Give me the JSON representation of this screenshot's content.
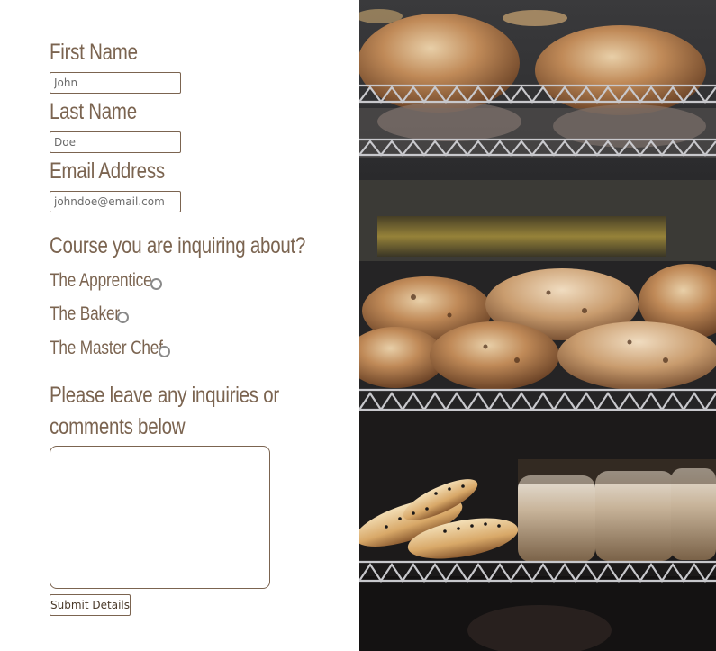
{
  "form": {
    "fields": [
      {
        "label": "First Name",
        "placeholder": "John"
      },
      {
        "label": "Last Name",
        "placeholder": "Doe"
      },
      {
        "label": "Email Address",
        "placeholder": "johndoe@email.com"
      }
    ],
    "course_heading": "Course you are inquiring about?",
    "courses": [
      "The Apprentice",
      "The Baker",
      "The Master Chef"
    ],
    "comments_heading_line1": "Please leave any inquiries or",
    "comments_heading_line2": "comments below",
    "submit_label": "Submit Details"
  },
  "photo": {
    "subject": "bakery display shelves with bread loaves and poppy-seed rolls"
  },
  "colors": {
    "label_brown": "#7b6450",
    "radio_gray": "#8a8a8a"
  }
}
